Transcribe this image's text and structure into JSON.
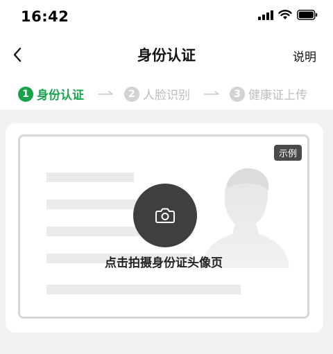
{
  "status_bar": {
    "time": "16:42",
    "icons": [
      "signal-icon",
      "wifi-icon",
      "battery-icon"
    ]
  },
  "nav": {
    "back_icon": "chevron-left-icon",
    "title": "身份认证",
    "help": "说明"
  },
  "steps": [
    {
      "number": "1",
      "label": "身份认证",
      "state": "active"
    },
    {
      "number": "2",
      "label": "人脸识别",
      "state": "inactive"
    },
    {
      "number": "3",
      "label": "健康证上传",
      "state": "inactive"
    }
  ],
  "id_card": {
    "badge": "示例",
    "camera_icon": "camera-icon",
    "prompt": "点击拍摄身份证头像页"
  },
  "colors": {
    "accent": "#17a34a",
    "inactive": "#bdbdbd",
    "background": "#f2f2f2",
    "camera_button": "#3f3f3f"
  }
}
